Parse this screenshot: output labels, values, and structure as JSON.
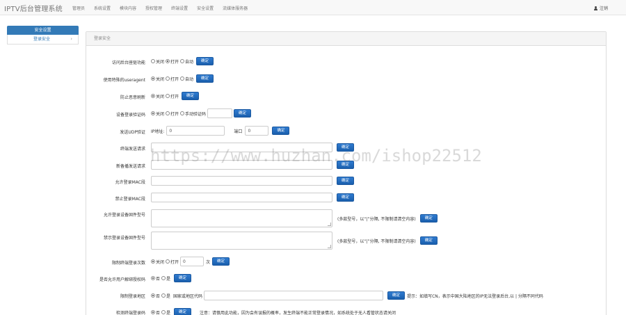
{
  "header": {
    "brand": "IPTV后台管理系统",
    "nav": [
      "管理员",
      "系统设置",
      "模块内容",
      "授权管理",
      "终端设置",
      "安全设置",
      "流媒体服务器"
    ],
    "logout": "注销"
  },
  "sidebar": {
    "title": "安全设置",
    "items": [
      {
        "label": "登录安全",
        "chevron": "chevron-right-icon"
      }
    ]
  },
  "panel": {
    "title": "登录安全"
  },
  "form": {
    "confirm": "确定",
    "rows": {
      "access_func": {
        "label": "访问后台座驱功能",
        "options": [
          "关闭",
          "打开",
          "自动"
        ],
        "selected": 1
      },
      "useragent": {
        "label": "使用特殊的useragent",
        "options": [
          "关闭",
          "打开",
          "自动"
        ],
        "selected": 0
      },
      "anti_refresh": {
        "label": "防止恶意刷新",
        "options": [
          "关闭",
          "打开"
        ],
        "selected": 0
      },
      "captcha": {
        "label": "设备登录验证码",
        "options": [
          "关闭",
          "打开",
          "手动验证码"
        ],
        "selected": 0,
        "value": ""
      },
      "udp": {
        "label": "发送UDP验证",
        "ip_label": "IP地址:",
        "ip_value": "0",
        "port_label": "端口",
        "port_value": "0"
      },
      "terminal_req": {
        "label": "终端发送请求",
        "value": ""
      },
      "set_req": {
        "label": "新备播发送请求",
        "value": ""
      },
      "allow_mac": {
        "label": "允许登录MAC段",
        "value": ""
      },
      "deny_mac": {
        "label": "禁止登录MAC段",
        "value": ""
      },
      "allow_model": {
        "label": "允许登录设备固件型号",
        "hint": "(多款型号，以“|”分隔, 不限制请清空内容)"
      },
      "deny_model": {
        "label": "禁示登录设备固件型号",
        "hint": "(多款型号，以“|”分隔, 不限制请清空内容)"
      },
      "limit_login": {
        "label": "限制终端登录次数",
        "options": [
          "关闭",
          "打开"
        ],
        "selected": 0,
        "value": "0",
        "unit": "次"
      },
      "allow_unbind": {
        "label": "是否允许用户解绑授权码",
        "options": [
          "否",
          "是"
        ],
        "selected": 0
      },
      "region": {
        "label": "限制登录地区",
        "options": [
          "否",
          "是"
        ],
        "selected": 0,
        "inline_label": "国家或地区代码",
        "value": "",
        "hint": "提示：如填写CN，表示中国大陆地区的IP无法登录后台,以 | 分隔不同代码"
      },
      "detect_terminal": {
        "label": "检测终端登录码",
        "options": [
          "否",
          "是"
        ],
        "selected": 0,
        "note": "注意：请慎用此功能，因为会有误报的概率，发生终端不能正常登录情况，如系统处于无人看管状态请关闭"
      }
    }
  },
  "watermark": "https://www.huzhan.com/ishop22512"
}
